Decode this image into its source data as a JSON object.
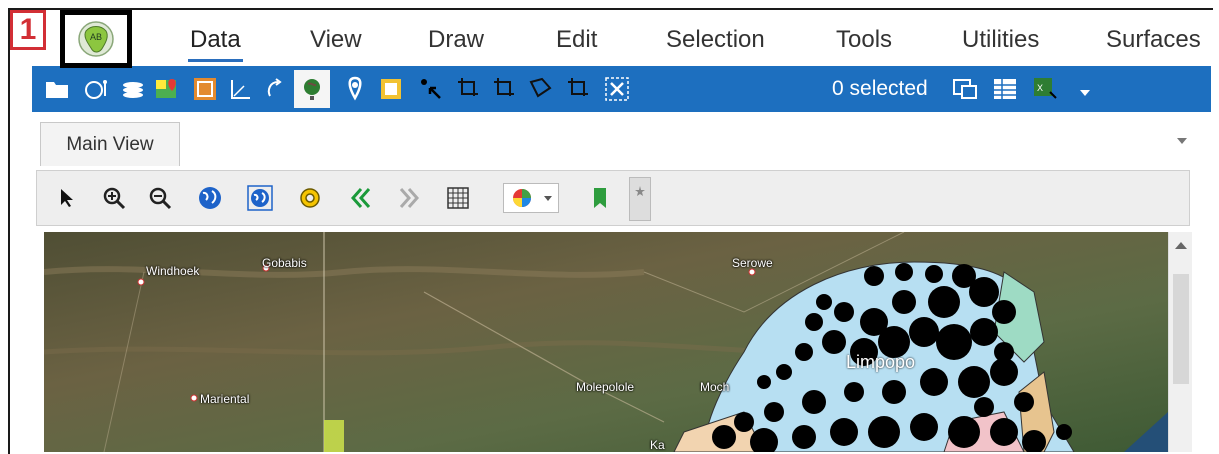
{
  "step": {
    "number": "1"
  },
  "app": {
    "logo_text": "AB"
  },
  "menu": {
    "items": [
      {
        "label": "Data",
        "active": true
      },
      {
        "label": "View",
        "active": false
      },
      {
        "label": "Draw",
        "active": false
      },
      {
        "label": "Edit",
        "active": false
      },
      {
        "label": "Selection",
        "active": false
      },
      {
        "label": "Tools",
        "active": false
      },
      {
        "label": "Utilities",
        "active": false
      },
      {
        "label": "Surfaces",
        "active": false
      }
    ]
  },
  "ribbon": {
    "selected_count_label": "0 selected",
    "icons": [
      "folder-icon",
      "palette-icon",
      "layers-icon",
      "map-pin-icon",
      "frame-icon",
      "measure-icon",
      "rotate-icon",
      "globe-icon",
      "location-pin-icon",
      "square-select-icon",
      "point-select-icon",
      "crop-select-icon",
      "crop-select-icon-2",
      "polygon-select-icon",
      "rect-select-icon",
      "clear-selection-icon",
      "export-selection-icon",
      "table-icon",
      "excel-export-icon",
      "more-dropdown-icon"
    ],
    "colors": {
      "background": "#1d6fbf"
    }
  },
  "tabs": {
    "main_view": "Main View"
  },
  "view_toolbar": {
    "icons": [
      "pointer-icon",
      "zoom-in-icon",
      "zoom-out-icon",
      "globe-full-icon",
      "globe-extent-icon",
      "settings-icon",
      "back-icon",
      "forward-icon",
      "grid-icon",
      "color-layer-dropdown-icon",
      "bookmark-icon",
      "star-icon"
    ]
  },
  "map": {
    "labels": {
      "windhoek": "Windhoek",
      "gobabis": "Gobabis",
      "serowe": "Serowe",
      "mariental": "Mariental",
      "molepolole": "Molepolole",
      "moch": "Moch",
      "ka": "Ka",
      "limpopo": "Limpopo"
    }
  }
}
